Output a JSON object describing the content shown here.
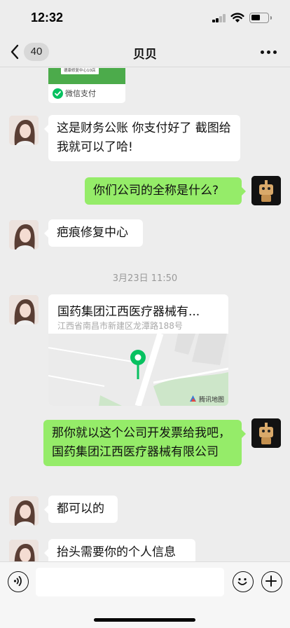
{
  "status_bar": {
    "time": "12:32"
  },
  "nav": {
    "unread_count": "40",
    "title": "贝贝"
  },
  "chat": {
    "payment_card": {
      "merchant": "德康修复中心10店",
      "footer": "微信支付"
    },
    "messages": [
      {
        "side": "left",
        "text": "这是财务公账 你支付好了 截图给我就可以了哈!"
      },
      {
        "side": "right",
        "text": "你们公司的全称是什么?"
      },
      {
        "side": "left",
        "text": "疤痕修复中心"
      },
      {
        "side": "right",
        "text": "那你就以这个公司开发票给我吧，国药集团江西医疗器械有限公司"
      },
      {
        "side": "left",
        "text": "都可以的"
      },
      {
        "side": "left",
        "text": "抬头需要你的个人信息"
      }
    ],
    "timestamp": "3月23日 11:50",
    "location": {
      "title": "国药集团江西医疗器械有...",
      "address": "江西省南昌市新建区龙潭路188号",
      "map_credit": "腾讯地图"
    }
  },
  "input_bar": {
    "placeholder": ""
  },
  "colors": {
    "background": "#ededed",
    "bubble_self": "#95ec69",
    "bubble_other": "#ffffff",
    "wechat_green": "#07c160"
  }
}
